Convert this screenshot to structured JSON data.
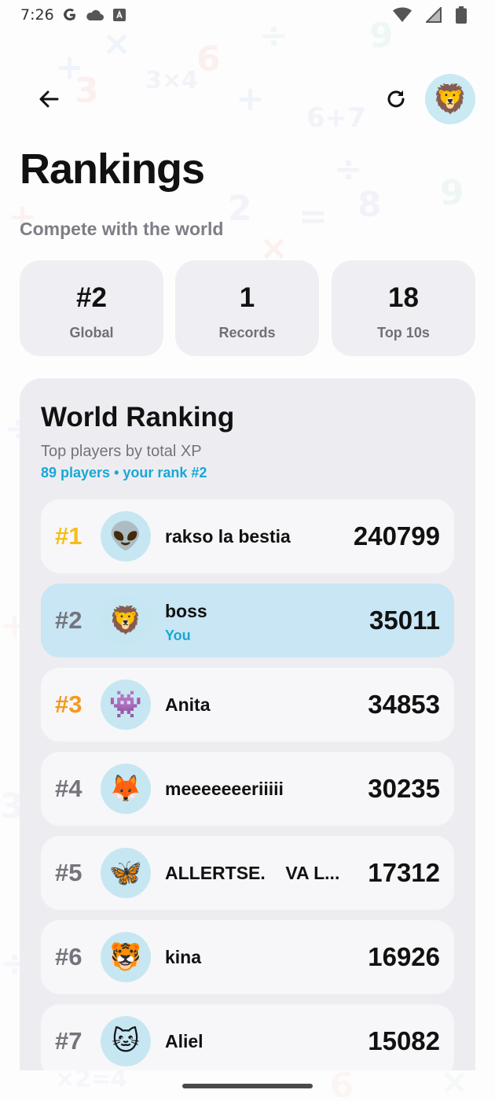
{
  "status_bar": {
    "time": "7:26",
    "icons": [
      "google-icon",
      "cloud-icon",
      "text-icon",
      "wifi-icon",
      "signal-icon",
      "battery-icon"
    ]
  },
  "header": {
    "title": "Rankings",
    "subtitle": "Compete with the world",
    "profile_avatar": "🦁"
  },
  "stats": [
    {
      "value": "#2",
      "label": "Global"
    },
    {
      "value": "1",
      "label": "Records"
    },
    {
      "value": "18",
      "label": "Top 10s"
    }
  ],
  "ranking": {
    "title": "World Ranking",
    "subtitle": "Top players by total XP",
    "meta": "89 players • your rank #2",
    "players": [
      {
        "rank": "#1",
        "avatar": "👽",
        "name": "rakso la bestia",
        "score": "240799"
      },
      {
        "rank": "#2",
        "avatar": "🦁",
        "name": "boss",
        "tag": "You",
        "score": "35011"
      },
      {
        "rank": "#3",
        "avatar": "👾",
        "name": "Anita",
        "score": "34853"
      },
      {
        "rank": "#4",
        "avatar": "🦊",
        "name": "meeeeeeeriiiii",
        "score": "30235"
      },
      {
        "rank": "#5",
        "avatar": "🦋",
        "name": "ALLERTSE.    VA L...",
        "score": "17312"
      },
      {
        "rank": "#6",
        "avatar": "🐯",
        "name": "kina",
        "score": "16926"
      },
      {
        "rank": "#7",
        "avatar": "🐱",
        "name": "Aliel",
        "score": "15082"
      }
    ]
  },
  "colors": {
    "accent": "#18a7d6",
    "gold": "#f5be19",
    "bronze": "#f39a1f",
    "highlight_row": "#c8e6f3",
    "card_bg": "#efeff3"
  }
}
